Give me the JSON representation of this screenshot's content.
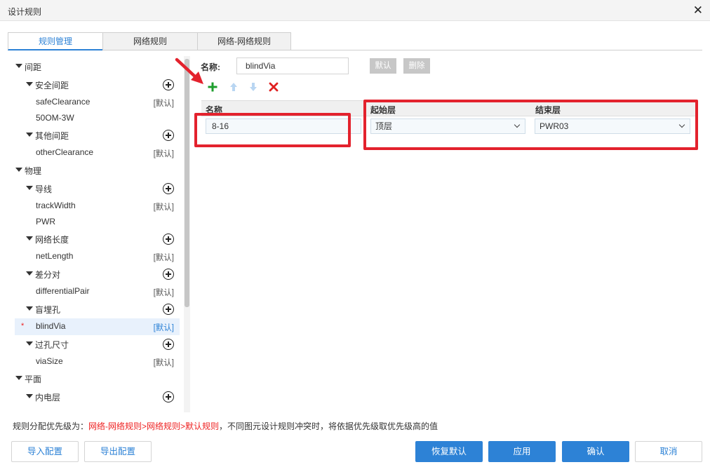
{
  "window": {
    "title": "设计规则",
    "close_symbol": "✕"
  },
  "tabs": [
    {
      "label": "规则管理",
      "active": true
    },
    {
      "label": "网络规则",
      "active": false
    },
    {
      "label": "网络-网络规则",
      "active": false
    }
  ],
  "tree": {
    "items": [
      {
        "label": "间距"
      },
      {
        "label": "安全间距"
      },
      {
        "label": "safeClearance",
        "tag": "[默认]"
      },
      {
        "label": "50OM-3W"
      },
      {
        "label": "其他间距"
      },
      {
        "label": "otherClearance",
        "tag": "[默认]"
      },
      {
        "label": "物理"
      },
      {
        "label": "导线"
      },
      {
        "label": "trackWidth",
        "tag": "[默认]"
      },
      {
        "label": "PWR"
      },
      {
        "label": "网络长度"
      },
      {
        "label": "netLength",
        "tag": "[默认]"
      },
      {
        "label": "差分对"
      },
      {
        "label": "differentialPair",
        "tag": "[默认]"
      },
      {
        "label": "盲埋孔"
      },
      {
        "label": "blindVia",
        "tag": "[默认]",
        "marker": "*"
      },
      {
        "label": "过孔尺寸"
      },
      {
        "label": "viaSize",
        "tag": "[默认]"
      },
      {
        "label": "平面"
      },
      {
        "label": "内电层"
      }
    ]
  },
  "editor": {
    "name_label": "名称:",
    "name_value": "blindVia",
    "default_button": "默认",
    "delete_button": "删除",
    "table": {
      "headers": [
        "名称",
        "起始层",
        "结束层"
      ],
      "rows": [
        {
          "name": "8-16",
          "start_layer": "顶层",
          "end_layer": "PWR03"
        }
      ]
    }
  },
  "footer": {
    "priority_prefix": "规则分配优先级为：",
    "priority_order": "网络-网络规则>网络规则>默认规则",
    "priority_suffix": "，不同图元设计规则冲突时，将依据优先级取优先级高的值",
    "buttons": {
      "import": "导入配置",
      "export": "导出配置",
      "restore": "恢复默认",
      "apply": "应用",
      "ok": "确认",
      "cancel": "取消"
    }
  },
  "colors": {
    "accent": "#2d82d6",
    "highlight": "#e3222d",
    "add": "#1e9e2e",
    "remove": "#e02020"
  }
}
